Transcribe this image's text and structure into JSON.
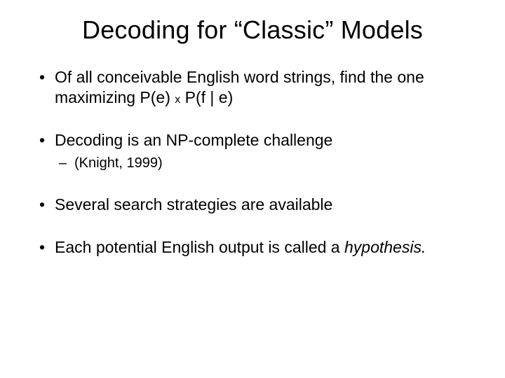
{
  "title": "Decoding for “Classic” Models",
  "bullets": {
    "b1a": "Of all conceivable English word strings, find the one maximizing P(e) ",
    "b1x": "x",
    "b1b": " P(f | e)",
    "b2": "Decoding is an NP-complete challenge",
    "b2sub": "(Knight, 1999)",
    "b3": "Several search strategies are available",
    "b4a": "Each potential English output is called a ",
    "b4b": "hypothesis.",
    "b4c": ""
  }
}
